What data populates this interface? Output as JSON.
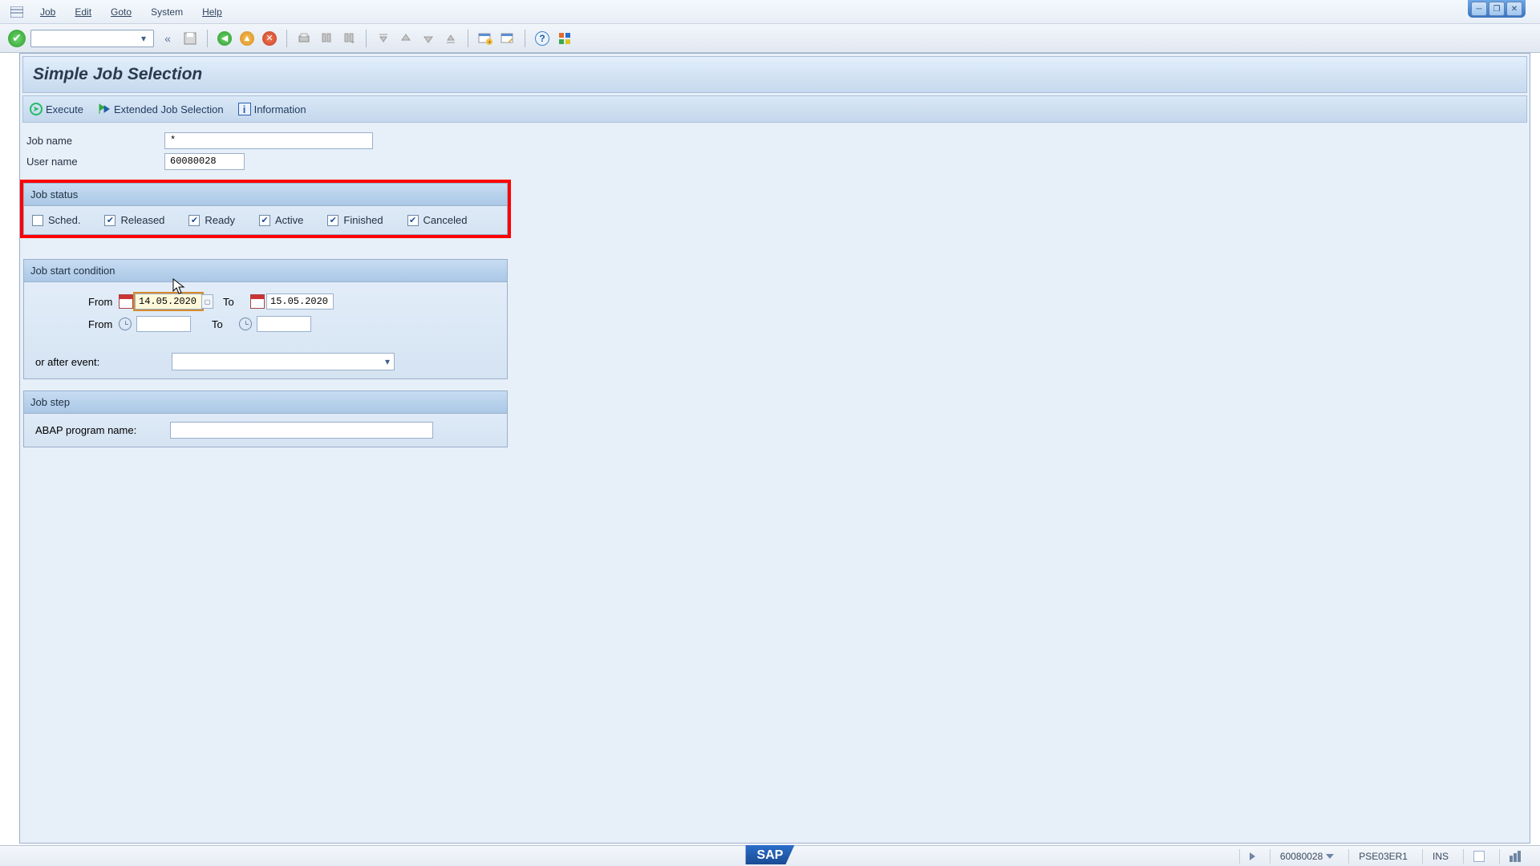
{
  "window": {
    "min": "─",
    "max": "❐",
    "close": "✕"
  },
  "menu": {
    "job": "Job",
    "edit": "Edit",
    "goto": "Goto",
    "system": "System",
    "help": "Help"
  },
  "toolbar": {
    "combo": "",
    "back": "«"
  },
  "page": {
    "title": "Simple Job Selection"
  },
  "actions": {
    "execute": "Execute",
    "extended": "Extended Job Selection",
    "info": "Information"
  },
  "fields": {
    "job_name_label": "Job name",
    "job_name_value": "*",
    "user_name_label": "User name",
    "user_name_value": "60080028"
  },
  "status_group": {
    "title": "Job status",
    "sched": {
      "label": "Sched.",
      "checked": false
    },
    "released": {
      "label": "Released",
      "checked": true
    },
    "ready": {
      "label": "Ready",
      "checked": true
    },
    "active": {
      "label": "Active",
      "checked": true
    },
    "finished": {
      "label": "Finished",
      "checked": true
    },
    "canceled": {
      "label": "Canceled",
      "checked": true
    }
  },
  "start_cond": {
    "title": "Job start condition",
    "from_lbl": "From",
    "to_lbl": "To",
    "from_date": "14.05.2020",
    "to_date": "15.05.2020",
    "from_time": "",
    "to_time": "",
    "event_lbl": "or after event:",
    "event_val": ""
  },
  "step": {
    "title": "Job step",
    "prog_lbl": "ABAP program name:",
    "prog_val": ""
  },
  "statusbar": {
    "user": "60080028",
    "system": "PSE03ER1",
    "mode": "INS",
    "sap": "SAP"
  }
}
